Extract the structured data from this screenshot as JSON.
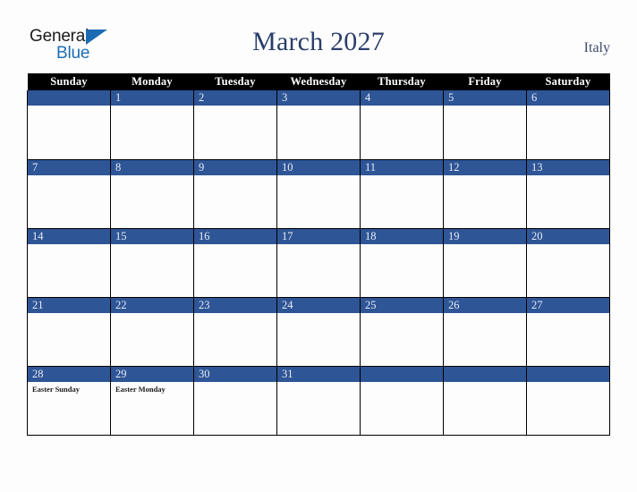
{
  "brand": {
    "name_top": "General",
    "name_bottom": "Blue",
    "color_black": "#1b1b1b",
    "color_blue": "#1c6cb4"
  },
  "header": {
    "title": "March 2027",
    "country": "Italy",
    "title_color": "#2a3e6b"
  },
  "theme": {
    "accent_blue": "#2e5596",
    "header_bar": "#000000",
    "page_background": "#fdfdfd",
    "daynum_text": "#e8ecf4"
  },
  "calendar": {
    "month": "March",
    "year": "2027",
    "weekday_headers": [
      "Sunday",
      "Monday",
      "Tuesday",
      "Wednesday",
      "Thursday",
      "Friday",
      "Saturday"
    ],
    "weeks": [
      [
        {
          "day": "",
          "events": []
        },
        {
          "day": "1",
          "events": []
        },
        {
          "day": "2",
          "events": []
        },
        {
          "day": "3",
          "events": []
        },
        {
          "day": "4",
          "events": []
        },
        {
          "day": "5",
          "events": []
        },
        {
          "day": "6",
          "events": []
        }
      ],
      [
        {
          "day": "7",
          "events": []
        },
        {
          "day": "8",
          "events": []
        },
        {
          "day": "9",
          "events": []
        },
        {
          "day": "10",
          "events": []
        },
        {
          "day": "11",
          "events": []
        },
        {
          "day": "12",
          "events": []
        },
        {
          "day": "13",
          "events": []
        }
      ],
      [
        {
          "day": "14",
          "events": []
        },
        {
          "day": "15",
          "events": []
        },
        {
          "day": "16",
          "events": []
        },
        {
          "day": "17",
          "events": []
        },
        {
          "day": "18",
          "events": []
        },
        {
          "day": "19",
          "events": []
        },
        {
          "day": "20",
          "events": []
        }
      ],
      [
        {
          "day": "21",
          "events": []
        },
        {
          "day": "22",
          "events": []
        },
        {
          "day": "23",
          "events": []
        },
        {
          "day": "24",
          "events": []
        },
        {
          "day": "25",
          "events": []
        },
        {
          "day": "26",
          "events": []
        },
        {
          "day": "27",
          "events": []
        }
      ],
      [
        {
          "day": "28",
          "events": [
            "Easter Sunday"
          ]
        },
        {
          "day": "29",
          "events": [
            "Easter Monday"
          ]
        },
        {
          "day": "30",
          "events": []
        },
        {
          "day": "31",
          "events": []
        },
        {
          "day": "",
          "events": []
        },
        {
          "day": "",
          "events": []
        },
        {
          "day": "",
          "events": []
        }
      ]
    ]
  }
}
